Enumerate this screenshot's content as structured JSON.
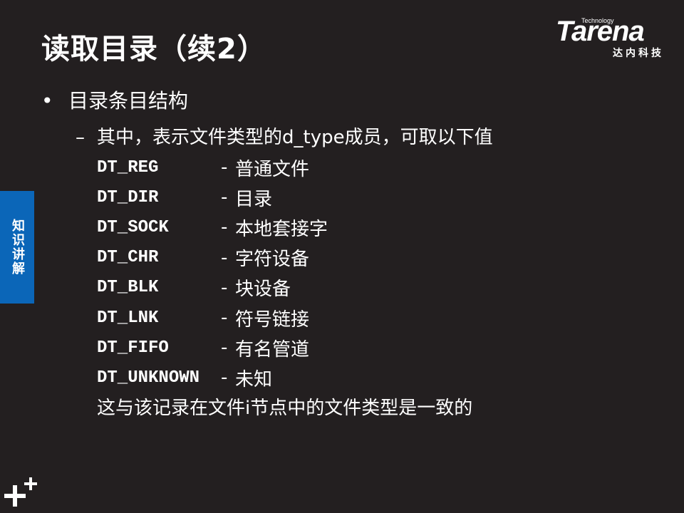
{
  "slide": {
    "title": "读取目录（续2）",
    "logo": {
      "tagline": "Technology",
      "wordmark": "Tarena",
      "chinese": "达内科技"
    },
    "side_tab": "知识讲解",
    "bullet": {
      "marker": "•",
      "text": "目录条目结构"
    },
    "sub_item": {
      "marker": "–",
      "text": "其中，表示文件类型的d_type成员，可取以下值"
    },
    "types": [
      {
        "code": "DT_REG",
        "desc": "普通文件"
      },
      {
        "code": "DT_DIR",
        "desc": "目录"
      },
      {
        "code": "DT_SOCK",
        "desc": "本地套接字"
      },
      {
        "code": "DT_CHR",
        "desc": "字符设备"
      },
      {
        "code": "DT_BLK",
        "desc": "块设备"
      },
      {
        "code": "DT_LNK",
        "desc": "符号链接"
      },
      {
        "code": "DT_FIFO",
        "desc": "有名管道"
      },
      {
        "code": "DT_UNKNOWN",
        "desc": "未知"
      }
    ],
    "separator": "-",
    "note": "这与该记录在文件i节点中的文件类型是一致的"
  },
  "colors": {
    "background": "#231f20",
    "text": "#ffffff",
    "side_tab": "#0b66b8"
  }
}
